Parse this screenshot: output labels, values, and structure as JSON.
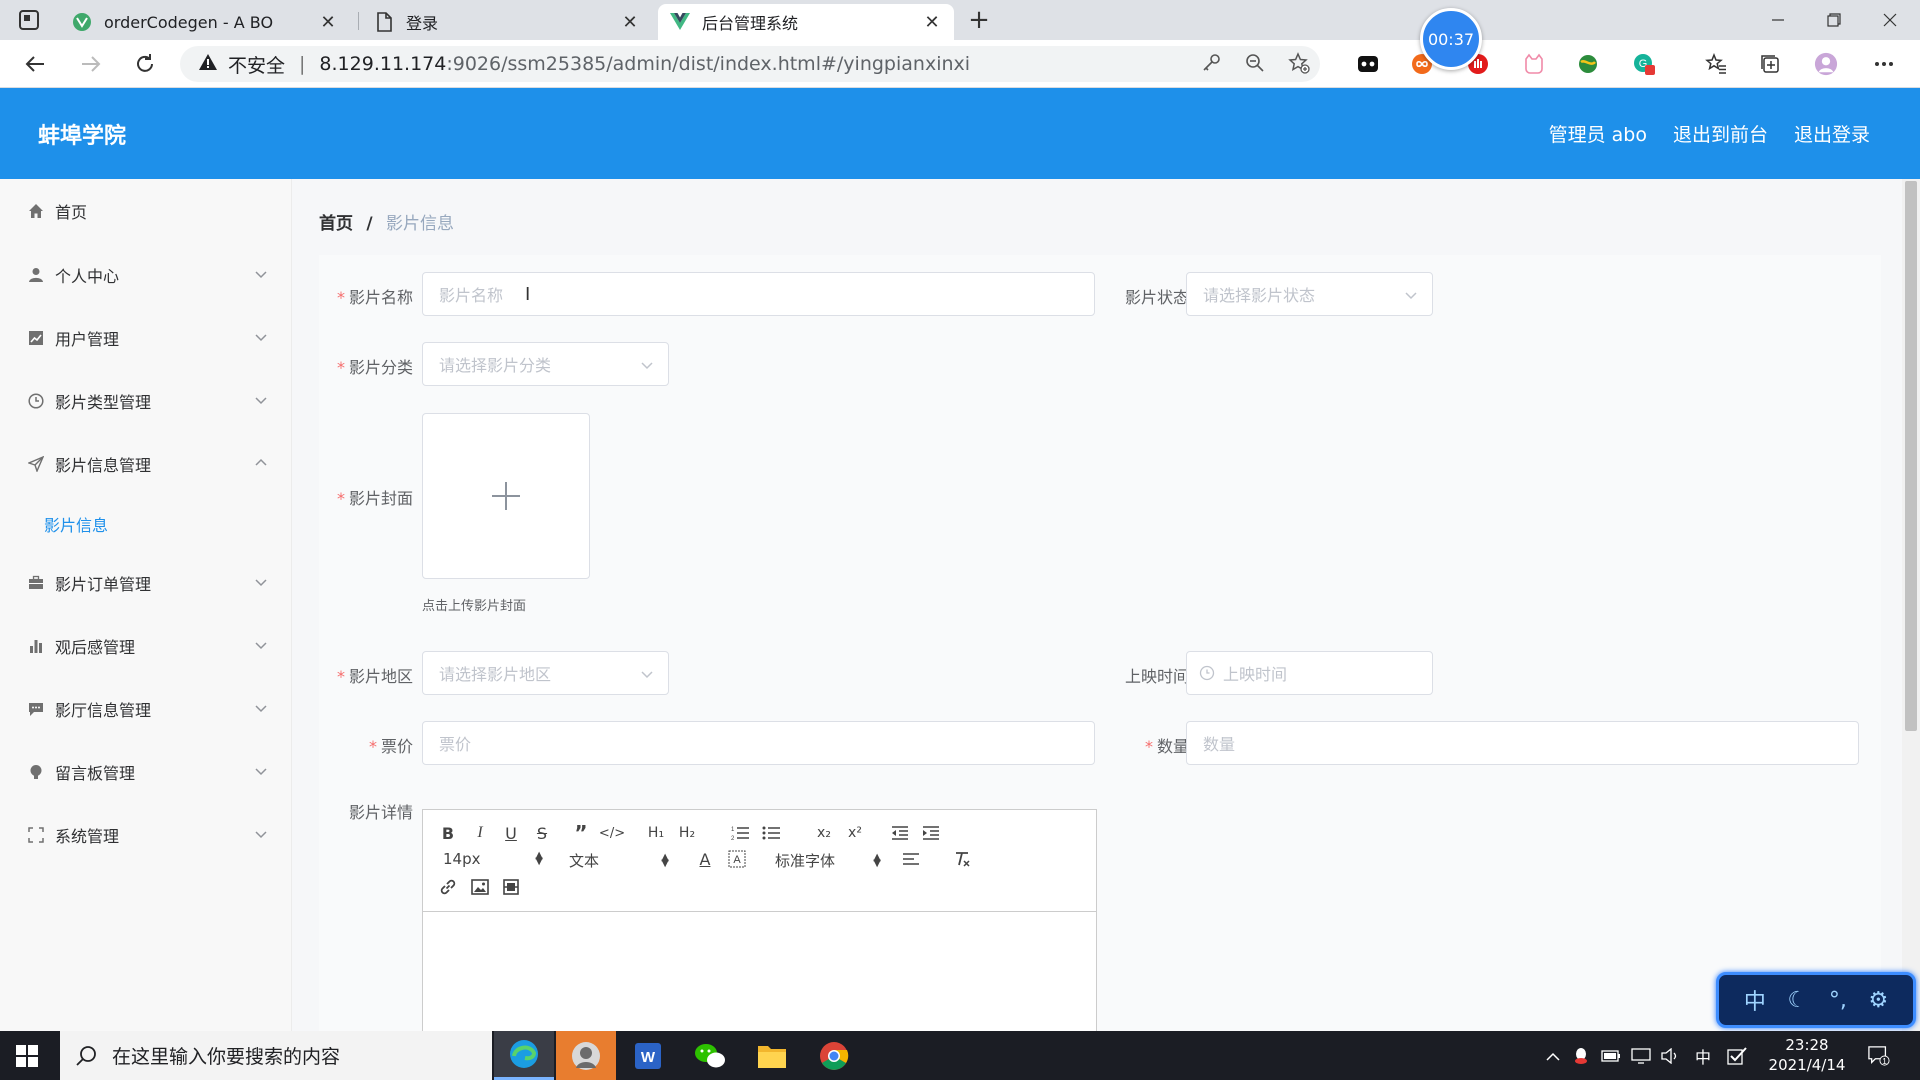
{
  "browser": {
    "tabs": [
      {
        "title": "orderCodegen - A BO"
      },
      {
        "title": "登录"
      },
      {
        "title": "后台管理系统"
      }
    ],
    "timer": "00:37",
    "address": {
      "warning": "不安全",
      "host": "8.129.11.174",
      "path": ":9026/ssm25385/admin/dist/index.html#/yingpianxinxi"
    }
  },
  "header": {
    "brand": "蚌埠学院",
    "user": "管理员 abo",
    "to_front": "退出到前台",
    "logout": "退出登录"
  },
  "sidebar": {
    "items": [
      {
        "label": "首页",
        "icon": "home-icon"
      },
      {
        "label": "个人中心",
        "icon": "user-icon"
      },
      {
        "label": "用户管理",
        "icon": "chart-icon"
      },
      {
        "label": "影片类型管理",
        "icon": "clock-icon"
      },
      {
        "label": "影片信息管理",
        "icon": "send-icon"
      },
      {
        "label": "影片订单管理",
        "icon": "briefcase-icon"
      },
      {
        "label": "观后感管理",
        "icon": "bar-chart-icon"
      },
      {
        "label": "影厅信息管理",
        "icon": "chat-icon"
      },
      {
        "label": "留言板管理",
        "icon": "bulb-icon"
      },
      {
        "label": "系统管理",
        "icon": "fullscreen-icon"
      }
    ],
    "sub_item": "影片信息"
  },
  "breadcrumb": {
    "home": "首页",
    "sep": "/",
    "current": "影片信息"
  },
  "form": {
    "name_label": "影片名称",
    "name_placeholder": "影片名称",
    "status_label": "影片状态",
    "status_placeholder": "请选择影片状态",
    "category_label": "影片分类",
    "category_placeholder": "请选择影片分类",
    "cover_label": "影片封面",
    "cover_tip": "点击上传影片封面",
    "region_label": "影片地区",
    "region_placeholder": "请选择影片地区",
    "release_label": "上映时间",
    "release_placeholder": "上映时间",
    "price_label": "票价",
    "price_placeholder": "票价",
    "qty_label": "数量",
    "qty_placeholder": "数量",
    "detail_label": "影片详情",
    "editor": {
      "font_size": "14px",
      "text_style": "文本",
      "font_family": "标准字体"
    }
  },
  "ime": {
    "lang": "中"
  },
  "taskbar": {
    "search_placeholder": "在这里输入你要搜索的内容",
    "ime_lang": "中",
    "time": "23:28",
    "date": "2021/4/14",
    "notify_count": "1"
  }
}
